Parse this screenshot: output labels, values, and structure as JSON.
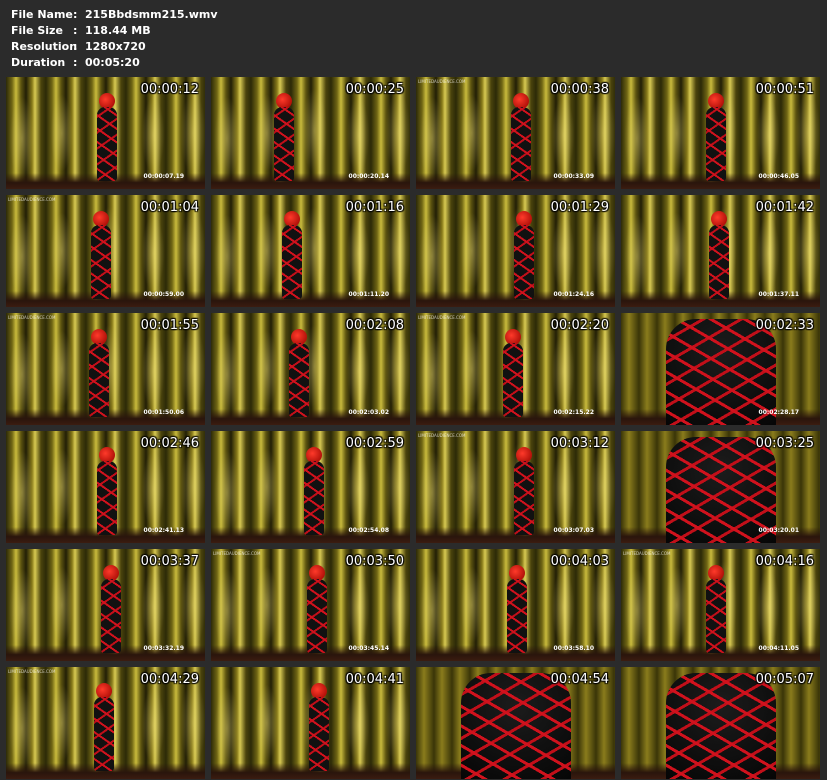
{
  "info": {
    "rows": [
      {
        "label": "File Name",
        "value": "215Bbdsmm215.wmv"
      },
      {
        "label": "File Size",
        "value": "118.44 MB"
      },
      {
        "label": "Resolution",
        "value": "1280x720"
      },
      {
        "label": "Duration",
        "value": "00:05:20"
      }
    ],
    "separator": ":"
  },
  "thumbnails": [
    {
      "time": "00:00:12",
      "frame_time": "00:00:07.19",
      "watermark": ""
    },
    {
      "time": "00:00:25",
      "frame_time": "00:00:20.14",
      "watermark": ""
    },
    {
      "time": "00:00:38",
      "frame_time": "00:00:33.09",
      "watermark": "LIMITEDAUDIENCE.COM"
    },
    {
      "time": "00:00:51",
      "frame_time": "00:00:46.05",
      "watermark": ""
    },
    {
      "time": "00:01:04",
      "frame_time": "00:00:59.00",
      "watermark": "LIMITEDAUDIENCE.COM"
    },
    {
      "time": "00:01:16",
      "frame_time": "00:01:11.20",
      "watermark": ""
    },
    {
      "time": "00:01:29",
      "frame_time": "00:01:24.16",
      "watermark": ""
    },
    {
      "time": "00:01:42",
      "frame_time": "00:01:37.11",
      "watermark": ""
    },
    {
      "time": "00:01:55",
      "frame_time": "00:01:50.06",
      "watermark": "LIMITEDAUDIENCE.COM"
    },
    {
      "time": "00:02:08",
      "frame_time": "00:02:03.02",
      "watermark": ""
    },
    {
      "time": "00:02:20",
      "frame_time": "00:02:15.22",
      "watermark": "LIMITEDAUDIENCE.COM"
    },
    {
      "time": "00:02:33",
      "frame_time": "00:02:28.17",
      "watermark": ""
    },
    {
      "time": "00:02:46",
      "frame_time": "00:02:41.13",
      "watermark": ""
    },
    {
      "time": "00:02:59",
      "frame_time": "00:02:54.08",
      "watermark": ""
    },
    {
      "time": "00:03:12",
      "frame_time": "00:03:07.03",
      "watermark": "LIMITEDAUDIENCE.COM"
    },
    {
      "time": "00:03:25",
      "frame_time": "00:03:20.01",
      "watermark": ""
    },
    {
      "time": "00:03:37",
      "frame_time": "00:03:32.19",
      "watermark": ""
    },
    {
      "time": "00:03:50",
      "frame_time": "00:03:45.14",
      "watermark": "LIMITEDAUDIENCE.COM"
    },
    {
      "time": "00:04:03",
      "frame_time": "00:03:58.10",
      "watermark": ""
    },
    {
      "time": "00:04:16",
      "frame_time": "00:04:11.05",
      "watermark": "LIMITEDAUDIENCE.COM"
    },
    {
      "time": "00:04:29",
      "frame_time": "",
      "watermark": "LIMITEDAUDIENCE.COM"
    },
    {
      "time": "00:04:41",
      "frame_time": "",
      "watermark": ""
    },
    {
      "time": "00:04:54",
      "frame_time": "",
      "watermark": ""
    },
    {
      "time": "00:05:07",
      "frame_time": "",
      "watermark": ""
    }
  ]
}
